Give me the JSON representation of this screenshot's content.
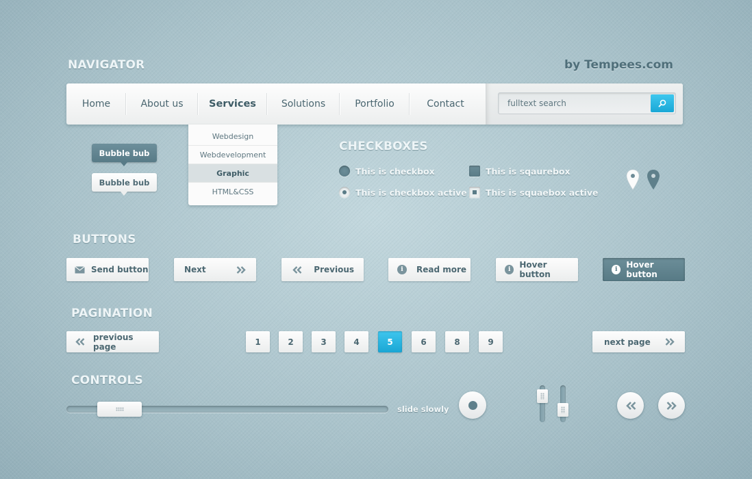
{
  "brand": {
    "title": "NAVIGATOR",
    "credit": "by Tempees.com"
  },
  "nav": {
    "items": [
      "Home",
      "About us",
      "Services",
      "Solutions",
      "Portfolio",
      "Contact"
    ],
    "active": "Services",
    "search": {
      "value": "fulltext search",
      "placeholder": "fulltext search"
    }
  },
  "dropdown": {
    "items": [
      "Webdesign",
      "Webdevelopment",
      "Graphic",
      "HTML&CSS"
    ],
    "active": "Graphic"
  },
  "bubbles": {
    "dark": "Bubble bub",
    "light": "Bubble bub"
  },
  "checkboxes": {
    "title": "CHECKBOXES",
    "radio": "This is checkbox",
    "radio_active": "This is checkbox active",
    "square": "This is sqaurebox",
    "square_active": "This is squaebox active"
  },
  "buttons": {
    "title": "BUTTONS",
    "send": "Send button",
    "next": "Next",
    "previous": "Previous",
    "read_more": "Read more",
    "hover": "Hover button",
    "hover_active": "Hover button"
  },
  "pagination": {
    "title": "PAGINATION",
    "prev": "previous page",
    "next": "next page",
    "pages": [
      "1",
      "2",
      "3",
      "4",
      "5",
      "6",
      "8",
      "9"
    ],
    "current": "5"
  },
  "controls": {
    "title": "CONTROLS",
    "slider_label": "slide slowly",
    "slider_value": 0.12,
    "vslider_1_value": 0.75,
    "vslider_2_value": 0.25
  },
  "colors": {
    "accent": "#1eaad8",
    "dark": "#5a7c87",
    "background": "#a7c1c9"
  }
}
